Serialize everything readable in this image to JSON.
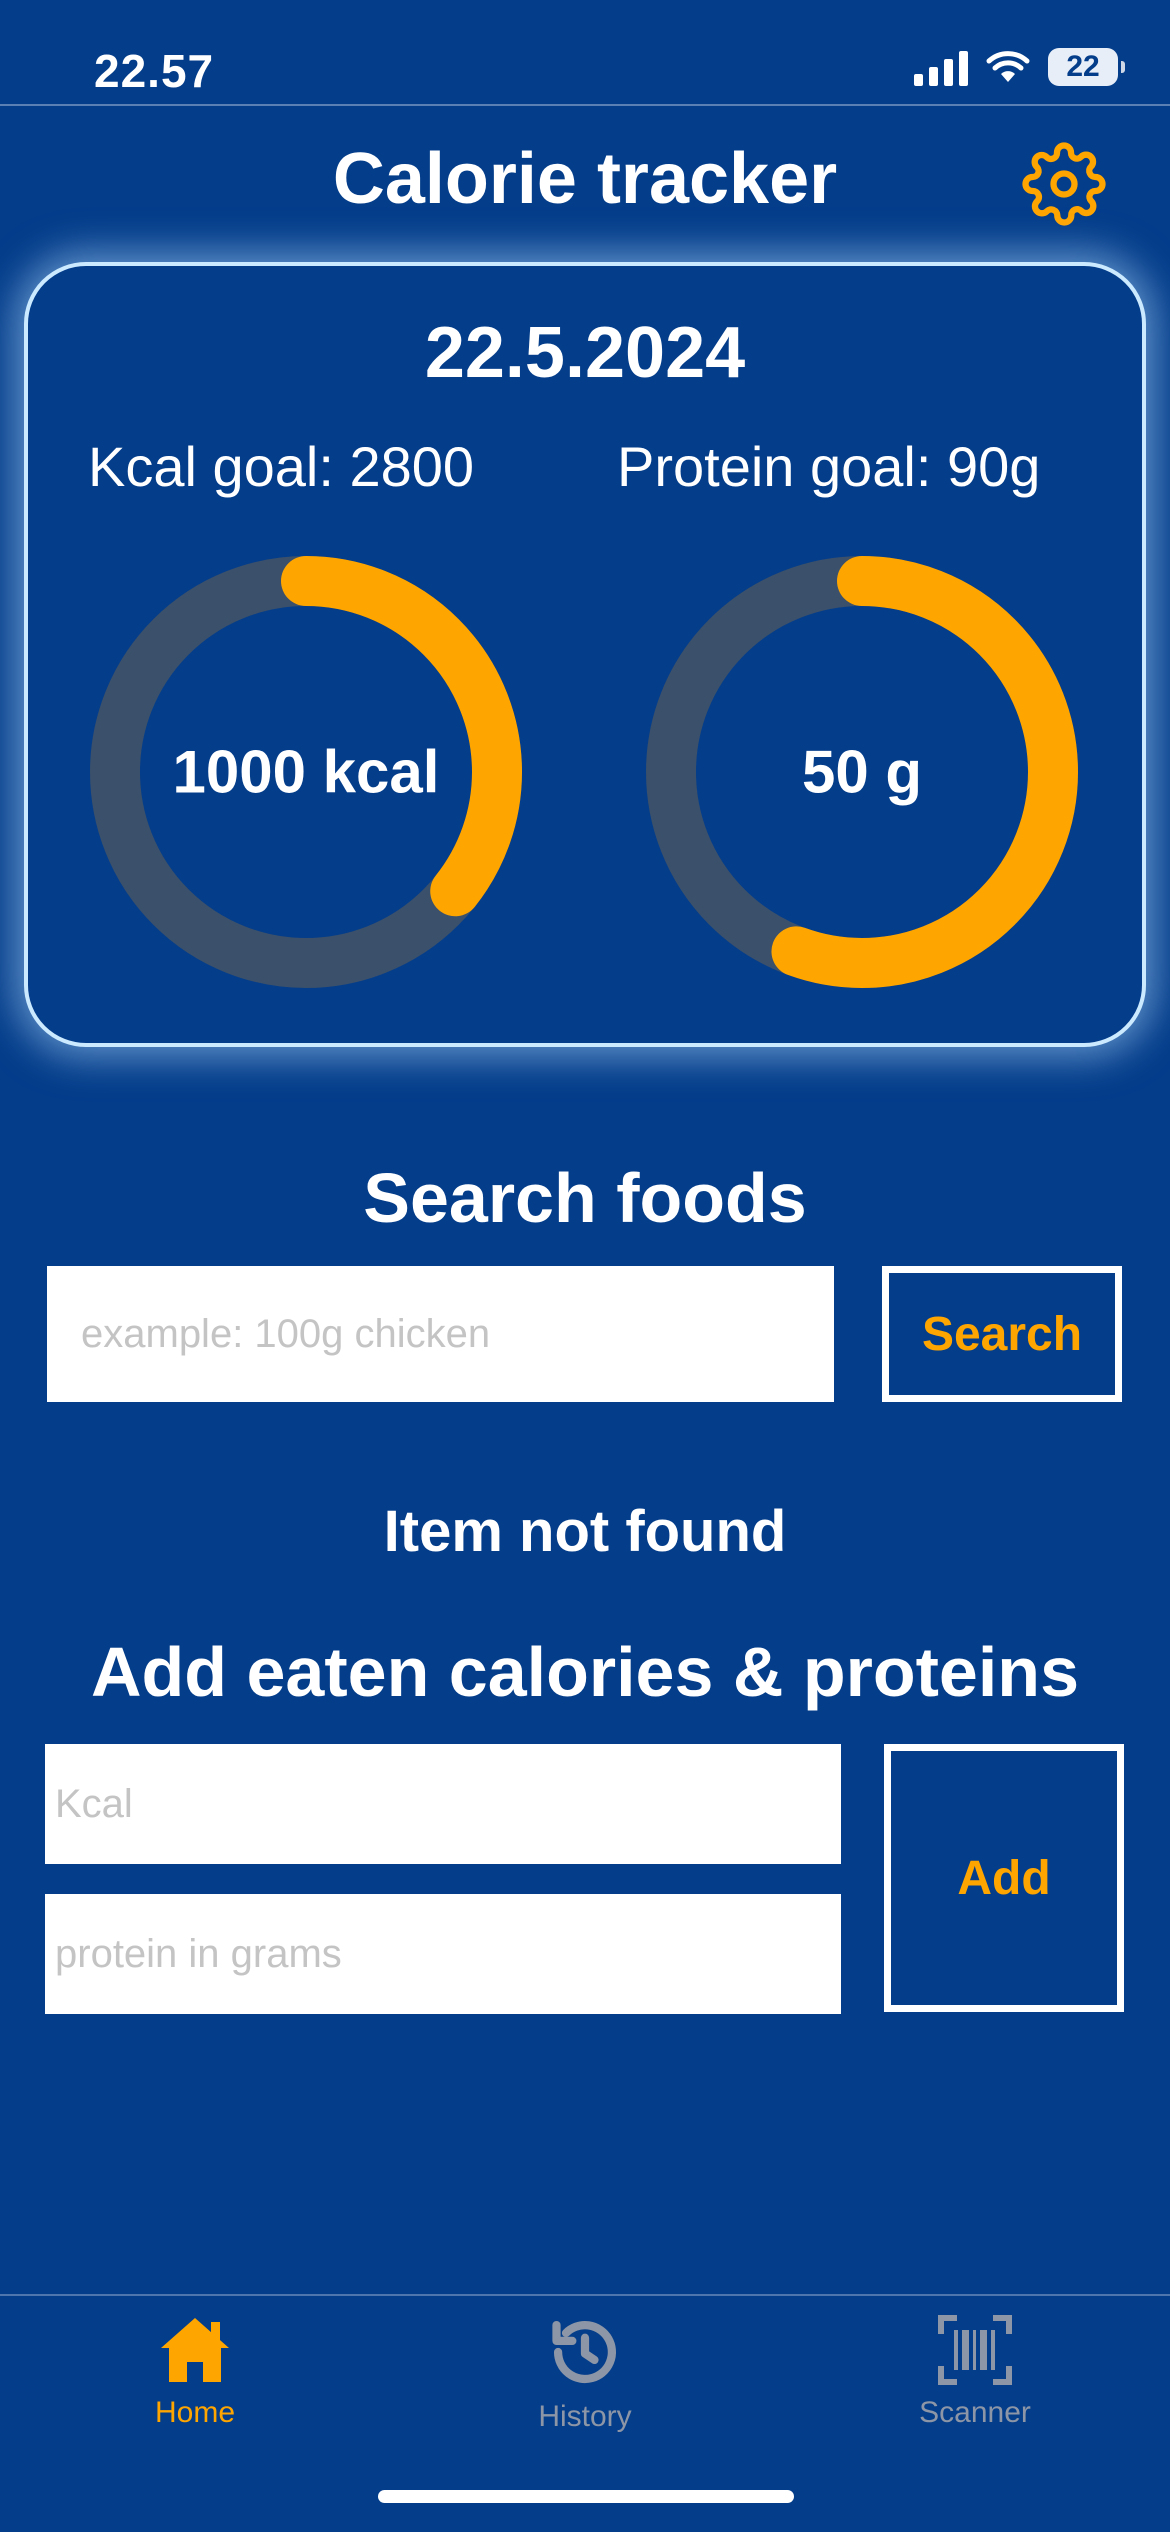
{
  "status_bar": {
    "time": "22.57",
    "battery": "22",
    "icons": [
      "signal-icon",
      "wifi-icon",
      "battery-icon"
    ]
  },
  "header": {
    "title": "Calorie tracker",
    "settings_icon": "gear-icon"
  },
  "summary": {
    "date": "22.5.2024",
    "kcal_goal_label": "Kcal goal: 2800",
    "protein_goal_label": "Protein goal: 90g",
    "kcal_goal": 2800,
    "kcal_eaten": 1000,
    "kcal_ring_label": "1000 kcal",
    "protein_goal": 90,
    "protein_eaten": 50,
    "protein_ring_label": "50 g"
  },
  "search": {
    "heading": "Search foods",
    "placeholder": "example: 100g chicken",
    "value": "",
    "button_label": "Search",
    "result_message": "Item not found"
  },
  "add": {
    "heading": "Add eaten calories & proteins",
    "kcal_placeholder": "Kcal",
    "protein_placeholder": "protein in grams",
    "button_label": "Add"
  },
  "tabs": [
    {
      "label": "Home",
      "icon": "home-icon",
      "active": true
    },
    {
      "label": "History",
      "icon": "history-icon",
      "active": false
    },
    {
      "label": "Scanner",
      "icon": "barcode-icon",
      "active": false
    }
  ],
  "colors": {
    "background": "#043d8a",
    "accent": "#ffa500",
    "ring_track": "#3a506b",
    "card_border": "#cbe9ff",
    "inactive_tab": "#8c96a6"
  }
}
